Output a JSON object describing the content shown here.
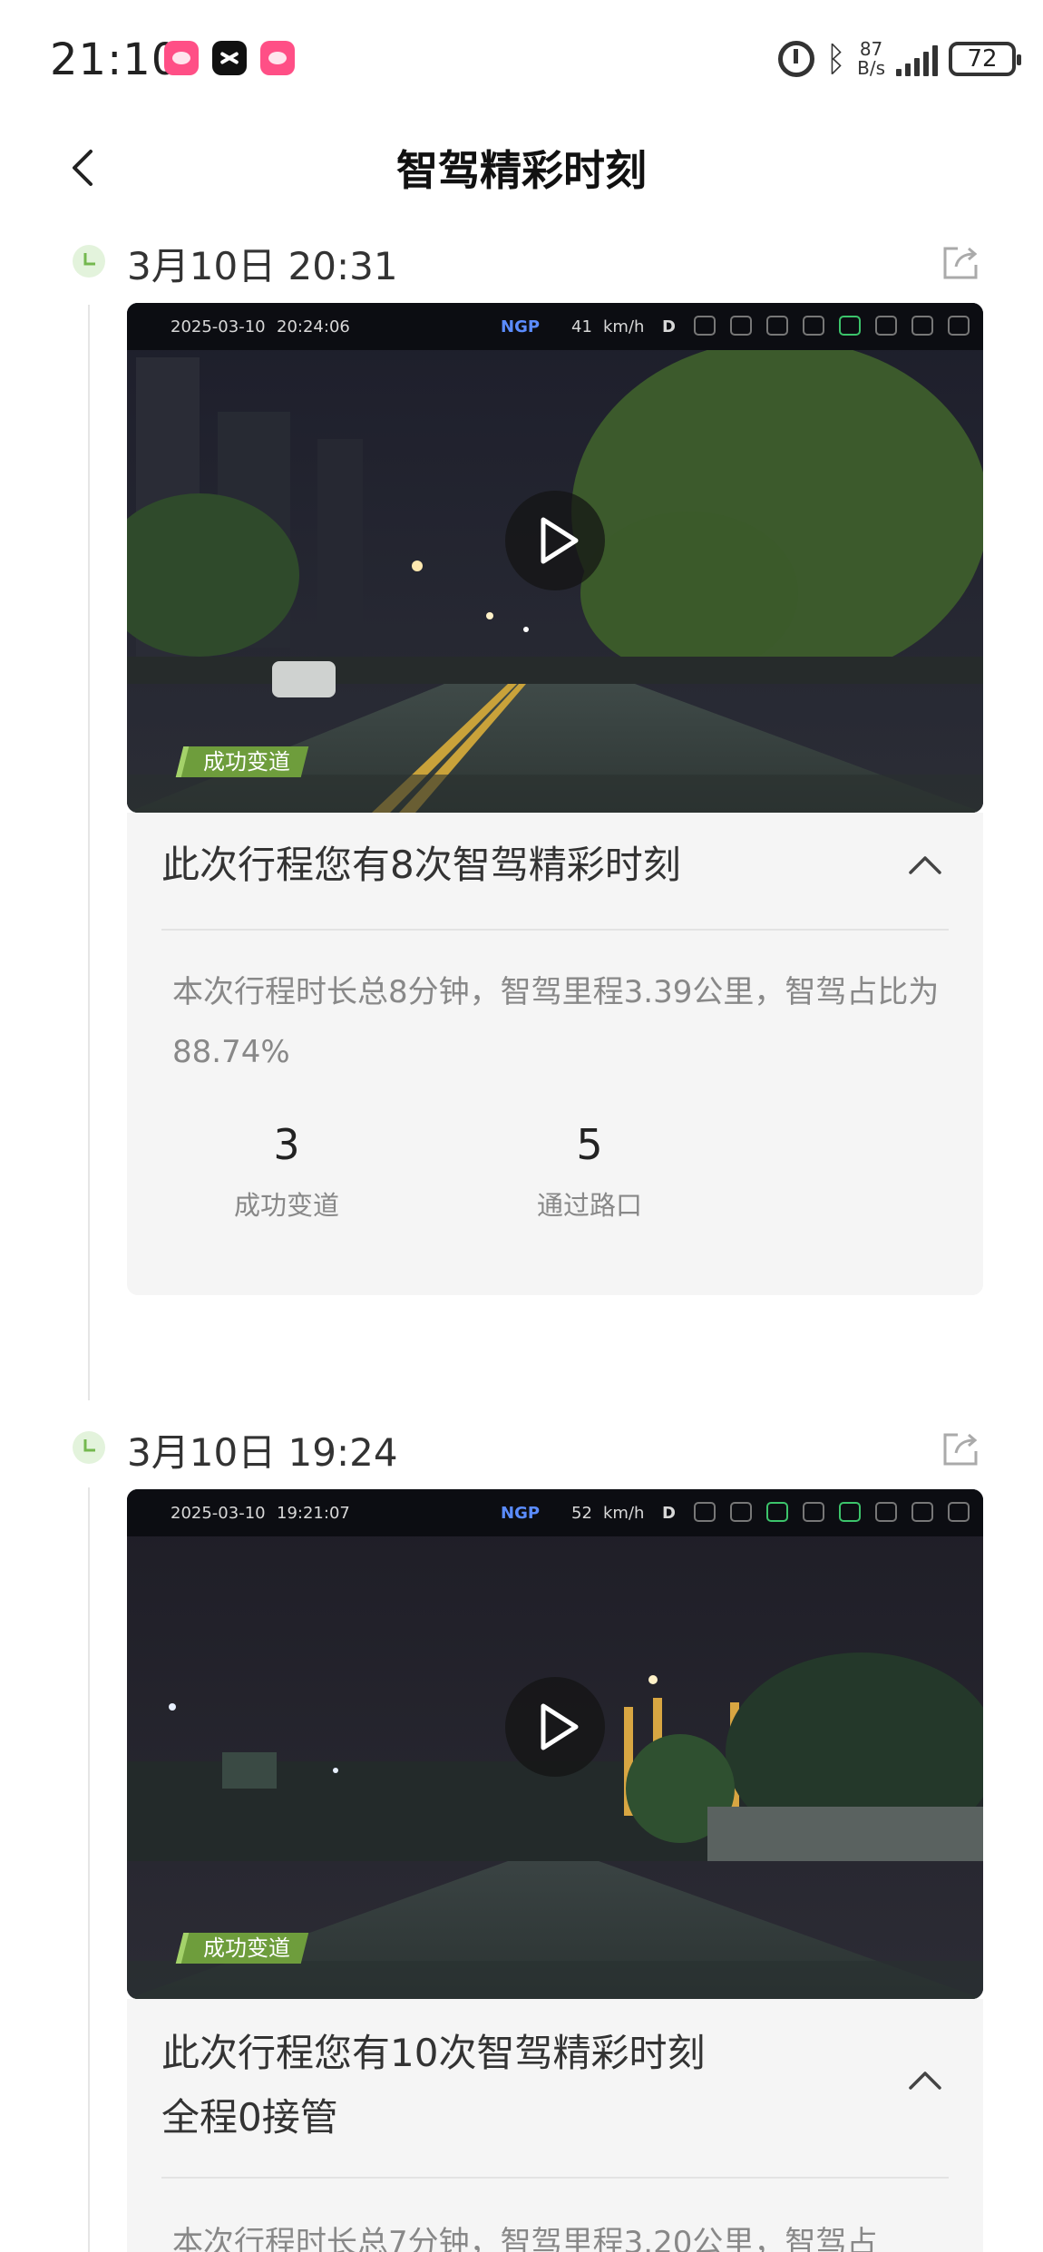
{
  "status_bar": {
    "time": "21:10",
    "net_speed_value": "87",
    "net_speed_unit": "B/s",
    "battery": "72",
    "icons": [
      "app-pink-icon",
      "app-capcut-icon",
      "app-pink-icon",
      "alarm-icon",
      "bluetooth-icon",
      "signal-icon",
      "battery-icon"
    ]
  },
  "header": {
    "title": "智驾精彩时刻",
    "back_icon": "chevron-left-icon"
  },
  "moments": [
    {
      "time": "3月10日 20:31",
      "video": {
        "osd_date": "2025-03-10",
        "osd_time": "20:24:06",
        "osd_mode": "NGP",
        "osd_speed": "41",
        "osd_speed_unit": "km/h",
        "osd_gear": "D",
        "badge": "成功变道"
      },
      "summary": {
        "title_line1": "此次行程您有8次智驾精彩时刻",
        "description": "本次行程时长总8分钟，智驾里程3.39公里，智驾占比为88.74%",
        "stats": [
          {
            "value": "3",
            "label": "成功变道"
          },
          {
            "value": "5",
            "label": "通过路口"
          }
        ]
      }
    },
    {
      "time": "3月10日 19:24",
      "video": {
        "osd_date": "2025-03-10",
        "osd_time": "19:21:07",
        "osd_mode": "NGP",
        "osd_speed": "52",
        "osd_speed_unit": "km/h",
        "osd_gear": "D",
        "badge": "成功变道"
      },
      "summary": {
        "title_line1": "此次行程您有10次智驾精彩时刻",
        "title_line2": "全程0接管",
        "description": "本次行程时长总7分钟，智驾里程3.20公里，智驾占"
      }
    }
  ],
  "colors": {
    "accent_green": "#6e9d3c",
    "ngp_blue": "#5b8cff",
    "card_bg": "#f5f5f5"
  }
}
